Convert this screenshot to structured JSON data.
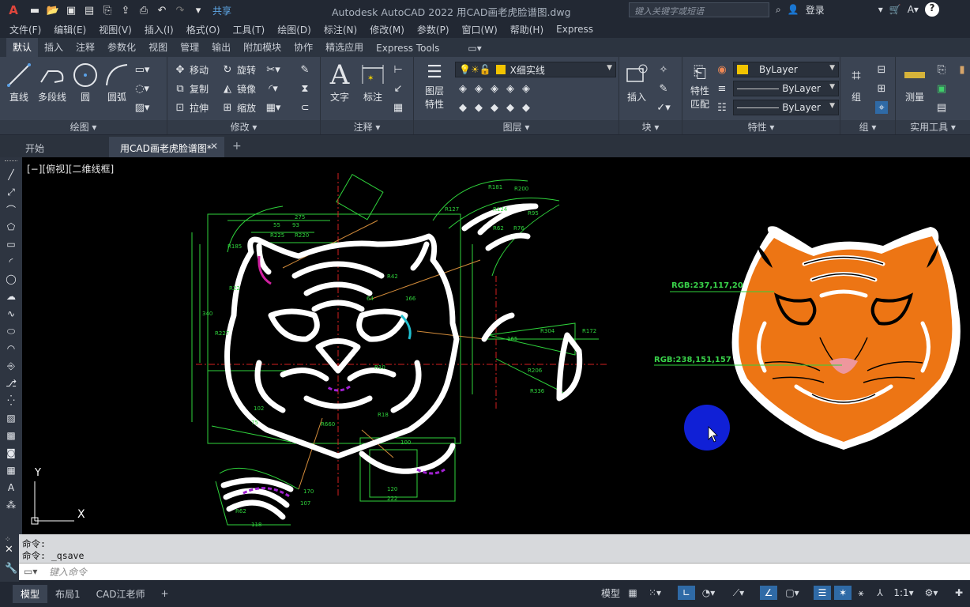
{
  "app": {
    "title": "Autodesk AutoCAD 2022    用CAD画老虎脸谱图.dwg",
    "share_label": "共享",
    "search_placeholder": "键入关键字或短语",
    "login_label": "登录",
    "logo_letter": "A"
  },
  "menu": [
    "文件(F)",
    "编辑(E)",
    "视图(V)",
    "插入(I)",
    "格式(O)",
    "工具(T)",
    "绘图(D)",
    "标注(N)",
    "修改(M)",
    "参数(P)",
    "窗口(W)",
    "帮助(H)",
    "Express"
  ],
  "ribbon_tabs": [
    "默认",
    "插入",
    "注释",
    "参数化",
    "视图",
    "管理",
    "输出",
    "附加模块",
    "协作",
    "精选应用",
    "Express Tools"
  ],
  "panels": {
    "draw": {
      "title": "绘图 ▾",
      "buttons": [
        {
          "label": "直线",
          "icon": "line-icon"
        },
        {
          "label": "多段线",
          "icon": "polyline-icon"
        },
        {
          "label": "圆",
          "icon": "circle-icon"
        },
        {
          "label": "圆弧",
          "icon": "arc-icon"
        }
      ]
    },
    "modify": {
      "title": "修改 ▾",
      "rows": [
        {
          "left": "移动",
          "right": "旋转"
        },
        {
          "left": "复制",
          "right": "镜像"
        },
        {
          "left": "拉伸",
          "right": "缩放"
        }
      ]
    },
    "annotation": {
      "title": "注释 ▾",
      "text_label": "文字",
      "dim_label": "标注"
    },
    "layers": {
      "title": "图层 ▾",
      "props_label_1": "图层",
      "props_label_2": "特性",
      "current_layer": "X细实线"
    },
    "block": {
      "title": "块 ▾",
      "insert_label": "插入"
    },
    "properties": {
      "title": "特性 ▾",
      "match_label_1": "特性",
      "match_label_2": "匹配",
      "color_value": "ByLayer",
      "linetype_value": "ByLayer",
      "lineweight_value": "ByLayer"
    },
    "groups": {
      "title": "组 ▾",
      "group_label": "组"
    },
    "utilities": {
      "title": "实用工具 ▾",
      "measure_label": "测量"
    }
  },
  "doc_tabs": {
    "start": "开始",
    "active": "用CAD画老虎脸谱图*",
    "add": "+"
  },
  "viewport": {
    "label": "[−][俯视][二维线框]",
    "annotations": [
      {
        "text": "RGB:237,117,20",
        "fill": "#ed7514"
      },
      {
        "text": "RGB:238,151,157",
        "fill": "#ee979d"
      }
    ],
    "ucs_x": "X",
    "ucs_y": "Y"
  },
  "command": {
    "history": [
      "命令:",
      "命令: _qsave"
    ],
    "placeholder": "键入命令"
  },
  "layout_tabs": [
    "模型",
    "布局1",
    "CAD江老师"
  ],
  "status": {
    "model_label": "模型",
    "scale": "1:1"
  },
  "colors": {
    "tiger_orange": "#ed7514",
    "tiger_nose": "#ee979d",
    "accent_green": "#39d24a",
    "cursor_highlight": "#1020d6"
  }
}
